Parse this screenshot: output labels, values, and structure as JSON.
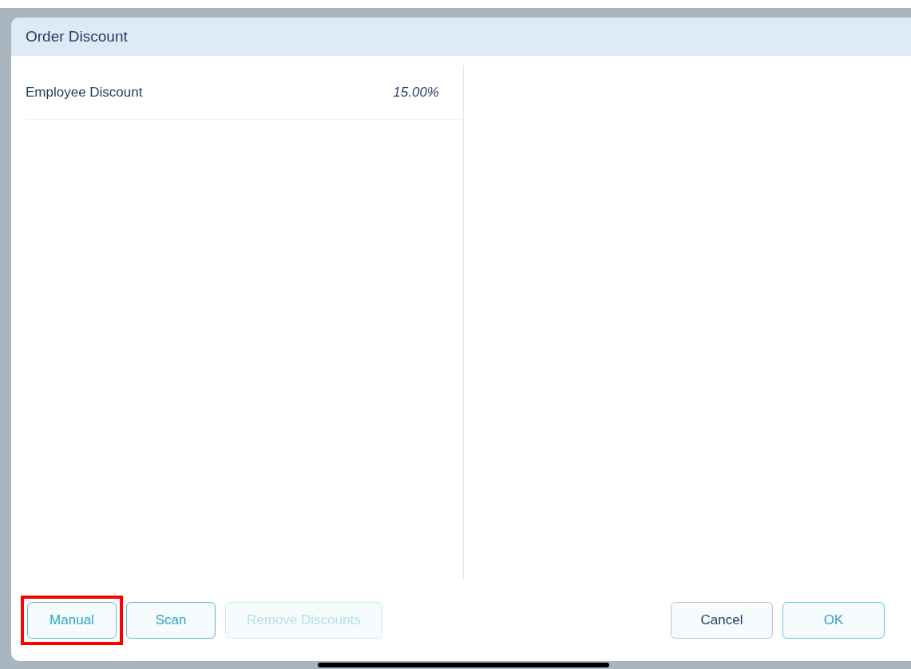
{
  "dialog": {
    "title": "Order Discount"
  },
  "discounts": [
    {
      "name": "Employee Discount",
      "amount": "15.00%"
    }
  ],
  "left_buttons": [
    {
      "label": "Manual",
      "disabled": false,
      "highlighted": true
    },
    {
      "label": "Scan",
      "disabled": false,
      "highlighted": false
    },
    {
      "label": "Remove Discounts",
      "disabled": true,
      "highlighted": false
    }
  ],
  "right_buttons": [
    {
      "label": "Cancel",
      "kind": "neutral"
    },
    {
      "label": "OK",
      "kind": "primary"
    }
  ]
}
